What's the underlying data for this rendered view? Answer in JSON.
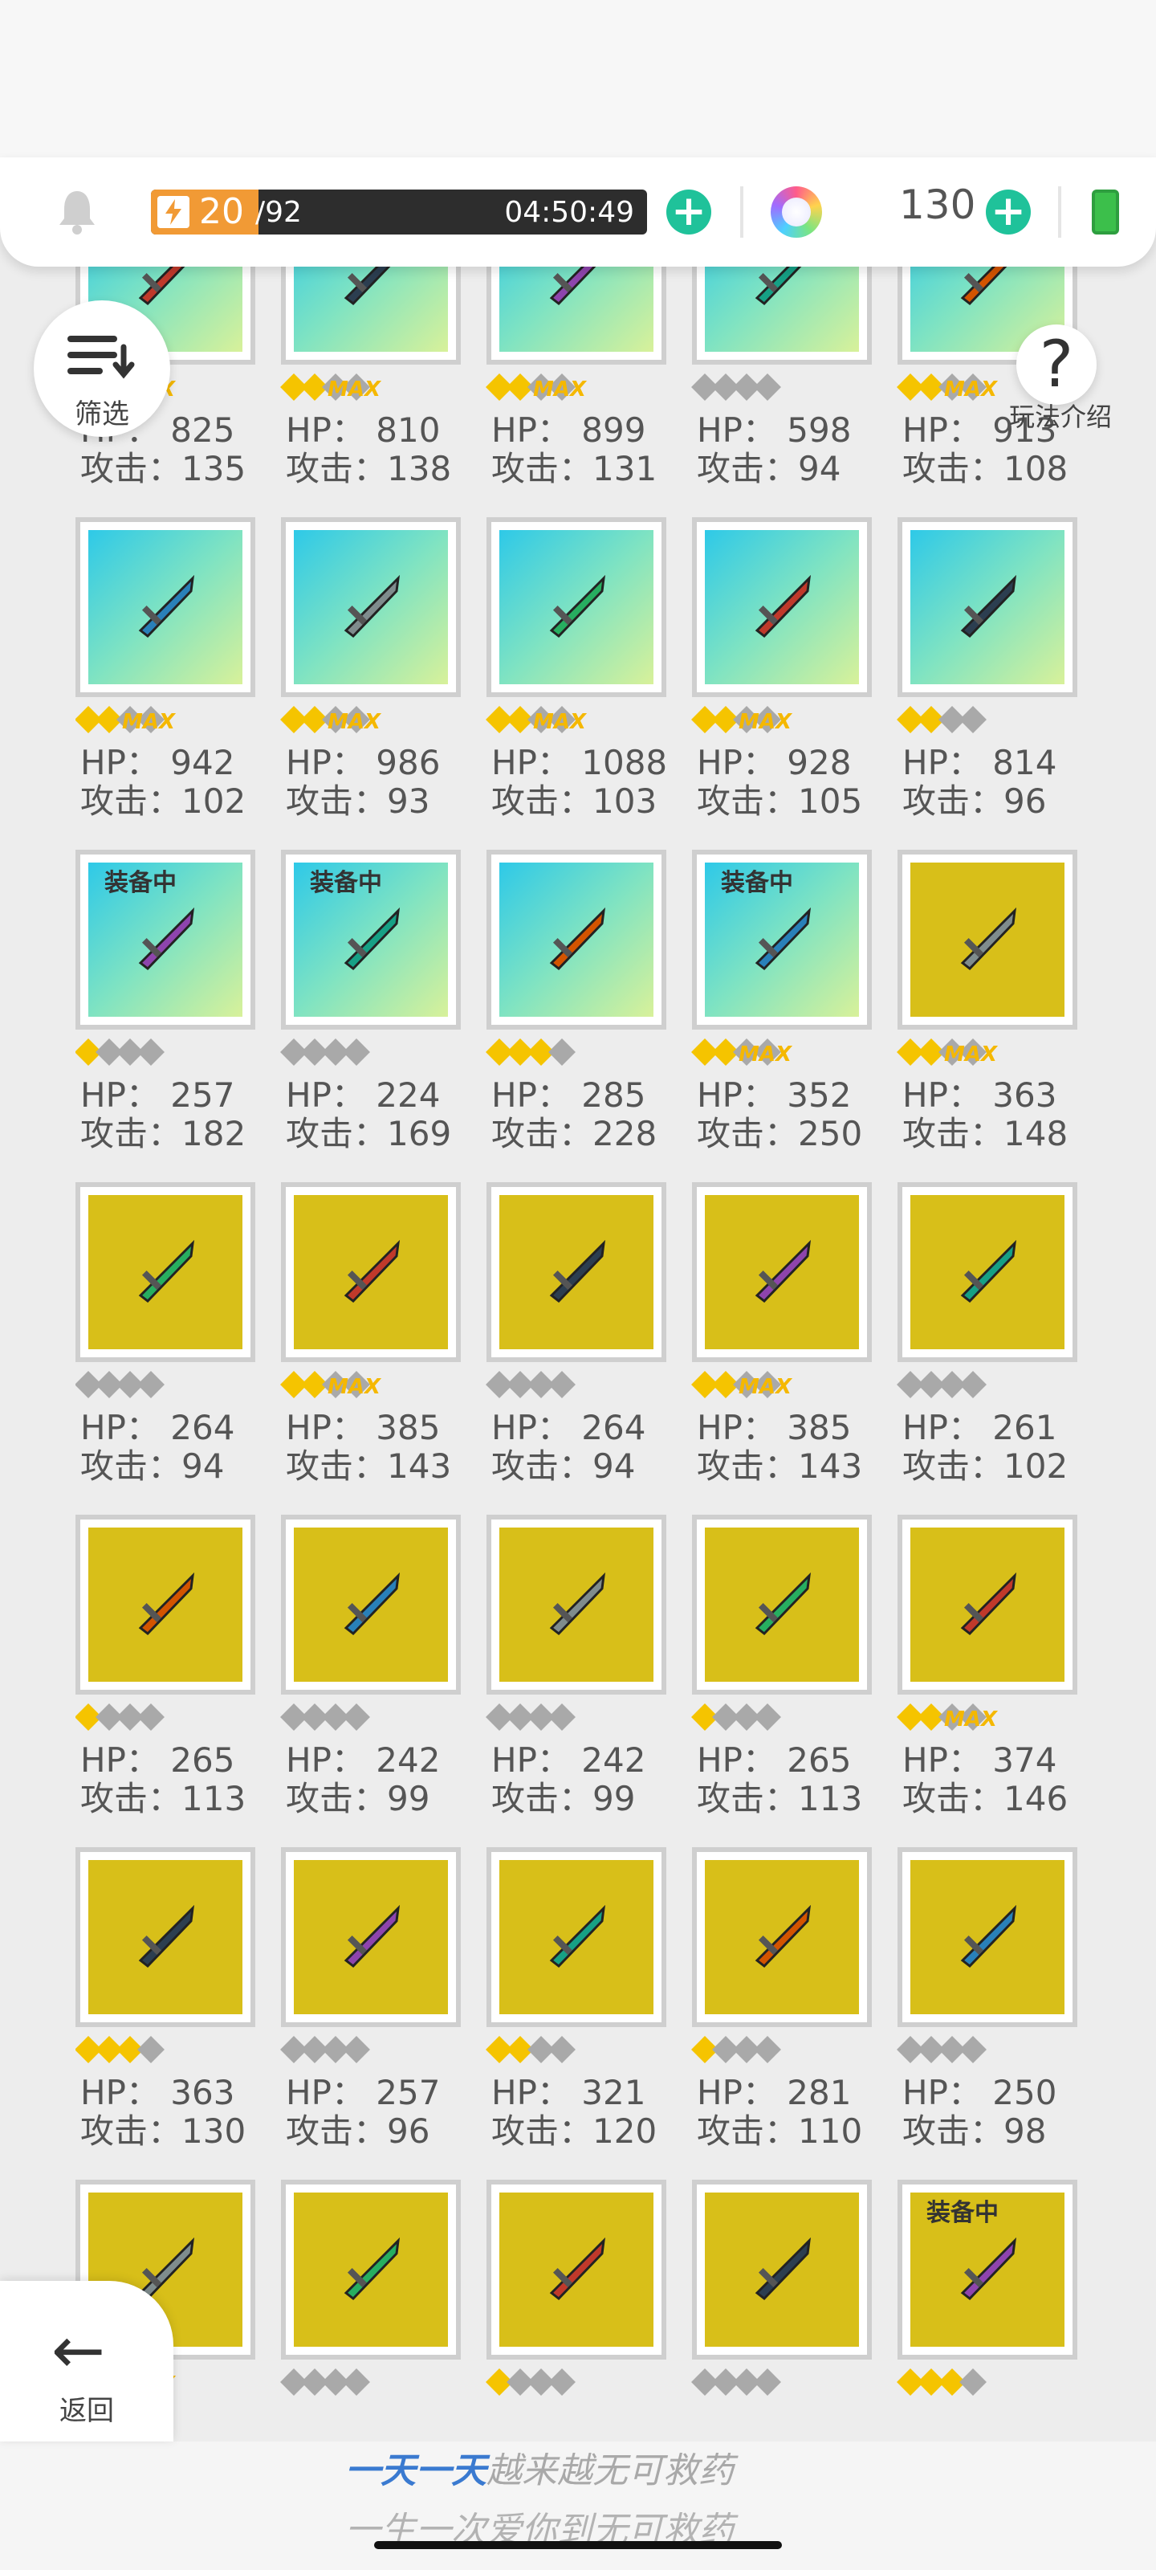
{
  "status": {
    "energy_current": "20",
    "energy_max": "92",
    "energy_fraction": 0.217,
    "timer": "04:50:49",
    "coins": "130"
  },
  "buttons": {
    "filter_label": "筛选",
    "help_label": "玩法介绍",
    "back_label": "返回",
    "max_tag": "MAX",
    "help_glyph": "?",
    "plus_glyph": "+",
    "back_glyph": "←"
  },
  "footer": {
    "slogan1_highlight": "一天一天",
    "slogan1_rest": "越来越无可救药",
    "slogan2": "一生一次爱你到无可救药"
  },
  "items": [
    {
      "bg": "aqua",
      "equipped": false,
      "stars": 2,
      "max": true,
      "hp": "HP： 825",
      "atk": "攻击：135",
      "icon": "shield"
    },
    {
      "bg": "aqua",
      "equipped": false,
      "stars": 2,
      "max": true,
      "hp": "HP： 810",
      "atk": "攻击：138",
      "icon": "robot-helmet"
    },
    {
      "bg": "aqua",
      "equipped": false,
      "stars": 2,
      "max": true,
      "hp": "HP： 899",
      "atk": "攻击：131",
      "icon": "wreath"
    },
    {
      "bg": "aqua",
      "equipped": false,
      "stars": 0,
      "max": false,
      "hp": "HP： 598",
      "atk": "攻击：94",
      "icon": "vest"
    },
    {
      "bg": "aqua",
      "equipped": false,
      "stars": 2,
      "max": true,
      "hp": "HP： 913",
      "atk": "攻击：108",
      "icon": "potion-necklace"
    },
    {
      "bg": "aqua",
      "equipped": false,
      "stars": 2,
      "max": true,
      "hp": "HP： 942",
      "atk": "攻击：102",
      "icon": "claw-pendant"
    },
    {
      "bg": "aqua",
      "equipped": false,
      "stars": 2,
      "max": true,
      "hp": "HP： 986",
      "atk": "攻击：93",
      "icon": "flask-amulet"
    },
    {
      "bg": "aqua",
      "equipped": false,
      "stars": 2,
      "max": true,
      "hp": "HP： 1088",
      "atk": "攻击：103",
      "icon": "flower-bouquet"
    },
    {
      "bg": "aqua",
      "equipped": false,
      "stars": 2,
      "max": true,
      "hp": "HP： 928",
      "atk": "攻击：105",
      "icon": "gem-bracelet"
    },
    {
      "bg": "aqua",
      "equipped": false,
      "stars": 2,
      "max": false,
      "hp": "HP： 814",
      "atk": "攻击：96",
      "icon": "boot"
    },
    {
      "bg": "aqua",
      "equipped": true,
      "equip_label": "装备中",
      "stars": 1,
      "max": false,
      "hp": "HP： 257",
      "atk": "攻击：182",
      "icon": "flame-rifle"
    },
    {
      "bg": "aqua",
      "equipped": true,
      "equip_label": "装备中",
      "stars": 0,
      "max": false,
      "hp": "HP： 224",
      "atk": "攻击：169",
      "icon": "crystal-blaster"
    },
    {
      "bg": "aqua",
      "equipped": false,
      "stars": 3,
      "max": false,
      "hp": "HP： 285",
      "atk": "攻击：228",
      "icon": "rocket-launcher"
    },
    {
      "bg": "aqua",
      "equipped": true,
      "equip_label": "装备中",
      "stars": 2,
      "max": true,
      "hp": "HP： 352",
      "atk": "攻击：250",
      "icon": "dark-cannon"
    },
    {
      "bg": "gold",
      "equipped": false,
      "stars": 2,
      "max": true,
      "hp": "HP： 363",
      "atk": "攻击：148",
      "icon": "ice-sword"
    },
    {
      "bg": "gold",
      "equipped": false,
      "stars": 0,
      "max": false,
      "hp": "HP： 264",
      "atk": "攻击：94",
      "icon": "steel-sword"
    },
    {
      "bg": "gold",
      "equipped": false,
      "stars": 2,
      "max": true,
      "hp": "HP： 385",
      "atk": "攻击：143",
      "icon": "bone-blade"
    },
    {
      "bg": "gold",
      "equipped": false,
      "stars": 0,
      "max": false,
      "hp": "HP： 264",
      "atk": "攻击：94",
      "icon": "blood-sword"
    },
    {
      "bg": "gold",
      "equipped": false,
      "stars": 2,
      "max": true,
      "hp": "HP： 385",
      "atk": "攻击：143",
      "icon": "frost-sword"
    },
    {
      "bg": "gold",
      "equipped": false,
      "stars": 0,
      "max": false,
      "hp": "HP： 261",
      "atk": "攻击：102",
      "icon": "laser-sword"
    },
    {
      "bg": "gold",
      "equipped": false,
      "stars": 1,
      "max": false,
      "hp": "HP： 265",
      "atk": "攻击：113",
      "icon": "copper-sword"
    },
    {
      "bg": "gold",
      "equipped": false,
      "stars": 0,
      "max": false,
      "hp": "HP： 242",
      "atk": "攻击：99",
      "icon": "battle-axe"
    },
    {
      "bg": "gold",
      "equipped": false,
      "stars": 0,
      "max": false,
      "hp": "HP： 242",
      "atk": "攻击：99",
      "icon": "scythe"
    },
    {
      "bg": "gold",
      "equipped": false,
      "stars": 1,
      "max": false,
      "hp": "HP： 265",
      "atk": "攻击：113",
      "icon": "mace"
    },
    {
      "bg": "gold",
      "equipped": false,
      "stars": 2,
      "max": true,
      "hp": "HP： 374",
      "atk": "攻击：146",
      "icon": "hammer"
    },
    {
      "bg": "gold",
      "equipped": false,
      "stars": 3,
      "max": false,
      "hp": "HP： 363",
      "atk": "攻击：130",
      "icon": "spear"
    },
    {
      "bg": "gold",
      "equipped": false,
      "stars": 0,
      "max": false,
      "hp": "HP： 257",
      "atk": "攻击：96",
      "icon": "halberd"
    },
    {
      "bg": "gold",
      "equipped": false,
      "stars": 2,
      "max": false,
      "hp": "HP： 321",
      "atk": "攻击：120",
      "icon": "cross-staff"
    },
    {
      "bg": "gold",
      "equipped": false,
      "stars": 1,
      "max": false,
      "hp": "HP： 281",
      "atk": "攻击：110",
      "icon": "star-staff"
    },
    {
      "bg": "gold",
      "equipped": false,
      "stars": 0,
      "max": false,
      "hp": "HP： 250",
      "atk": "攻击：98",
      "icon": "trident"
    },
    {
      "bg": "gold",
      "equipped": false,
      "stars": 2,
      "max": true,
      "hp": "",
      "atk": "",
      "icon": "golden-staff"
    },
    {
      "bg": "gold",
      "equipped": false,
      "stars": 0,
      "max": false,
      "hp": "",
      "atk": "",
      "icon": "green-staff"
    },
    {
      "bg": "gold",
      "equipped": false,
      "stars": 1,
      "max": false,
      "hp": "",
      "atk": "",
      "icon": "dark-bow"
    },
    {
      "bg": "gold",
      "equipped": false,
      "stars": 0,
      "max": false,
      "hp": "",
      "atk": "",
      "icon": "red-bow"
    },
    {
      "bg": "gold",
      "equipped": true,
      "equip_label": "装备中",
      "stars": 3,
      "max": false,
      "hp": "",
      "atk": "",
      "icon": "scroll-book"
    }
  ]
}
